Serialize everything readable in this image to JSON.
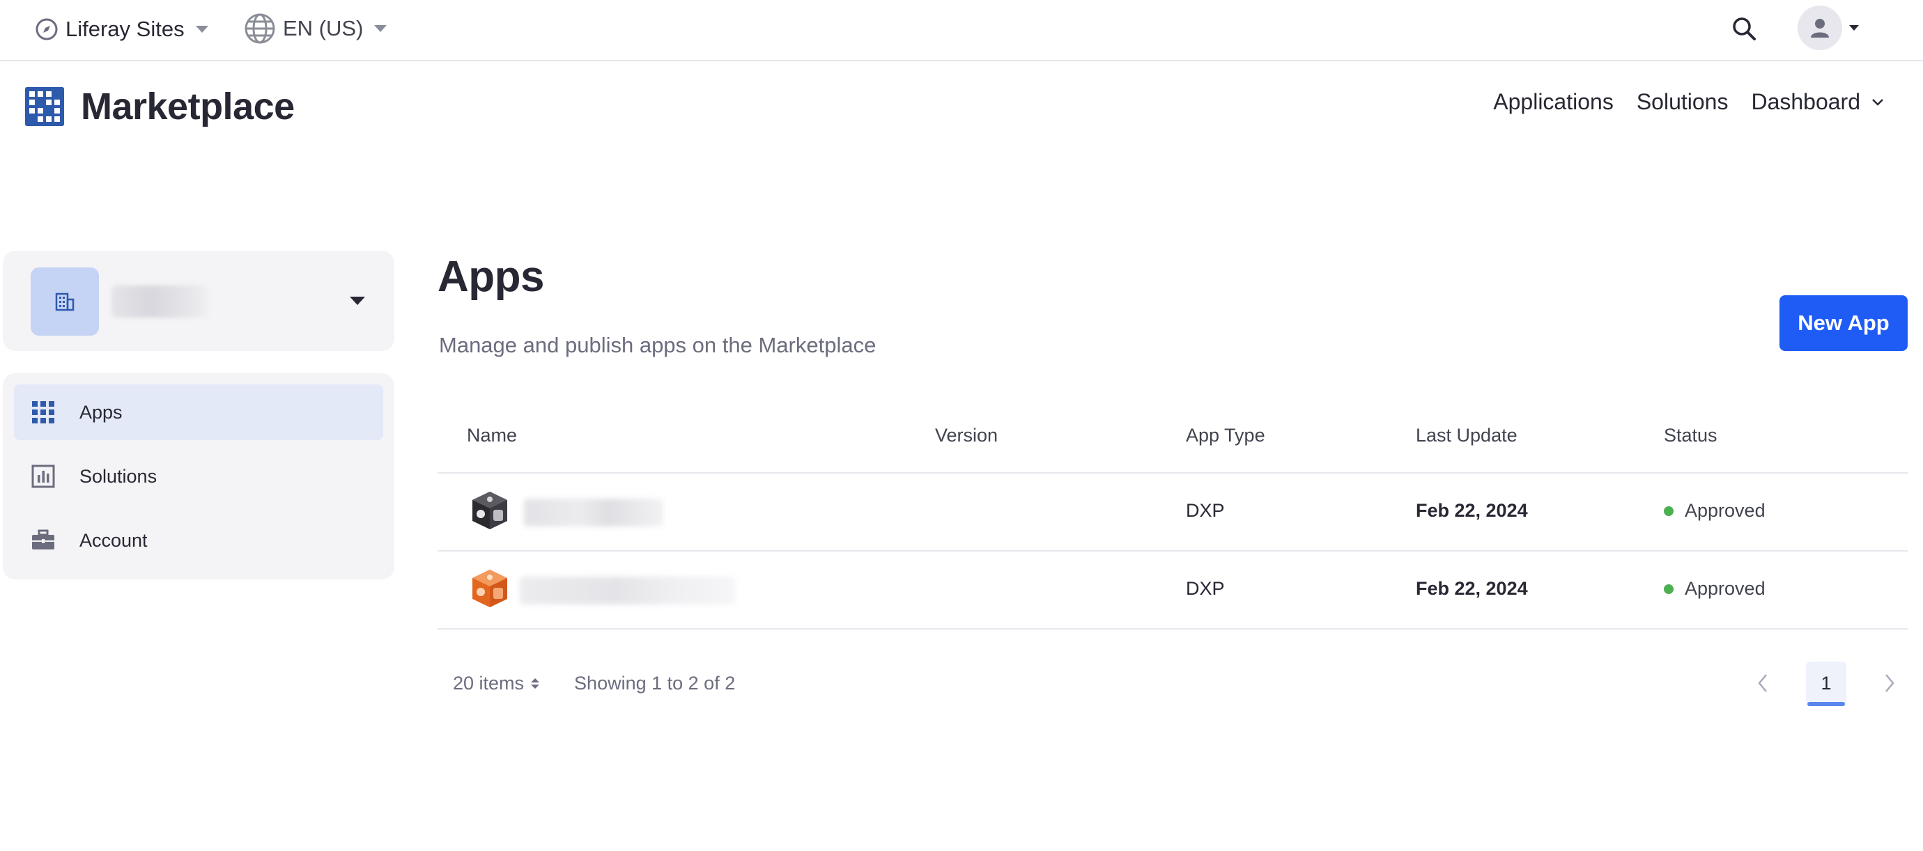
{
  "topbar": {
    "site_label": "Liferay Sites",
    "language_label": "EN (US)",
    "icons": {
      "site": "compass-icon",
      "language": "globe-icon",
      "search": "search-icon",
      "user": "user-icon"
    }
  },
  "header": {
    "brand_title": "Marketplace",
    "nav": [
      {
        "label": "Applications"
      },
      {
        "label": "Solutions"
      },
      {
        "label": "Dashboard"
      }
    ]
  },
  "sidebar": {
    "items": [
      {
        "label": "Apps",
        "icon": "grid-icon",
        "active": true
      },
      {
        "label": "Solutions",
        "icon": "chart-icon",
        "active": false
      },
      {
        "label": "Account",
        "icon": "briefcase-icon",
        "active": false
      }
    ]
  },
  "main": {
    "title": "Apps",
    "subtitle": "Manage and publish apps on the Marketplace",
    "new_app_label": "New App",
    "table": {
      "columns": [
        "Name",
        "Version",
        "App Type",
        "Last Update",
        "Status"
      ],
      "rows": [
        {
          "type": "DXP",
          "last_update": "Feb 22, 2024",
          "status": "Approved"
        },
        {
          "type": "DXP",
          "last_update": "Feb 22, 2024",
          "status": "Approved"
        }
      ]
    },
    "pagination": {
      "items_per_page": "20 items",
      "showing": "Showing 1 to 2 of 2",
      "current_page": "1"
    }
  },
  "colors": {
    "accent": "#1f5cf5",
    "status_approved": "#4caf50",
    "active_nav_bg": "#e4e9f8"
  }
}
